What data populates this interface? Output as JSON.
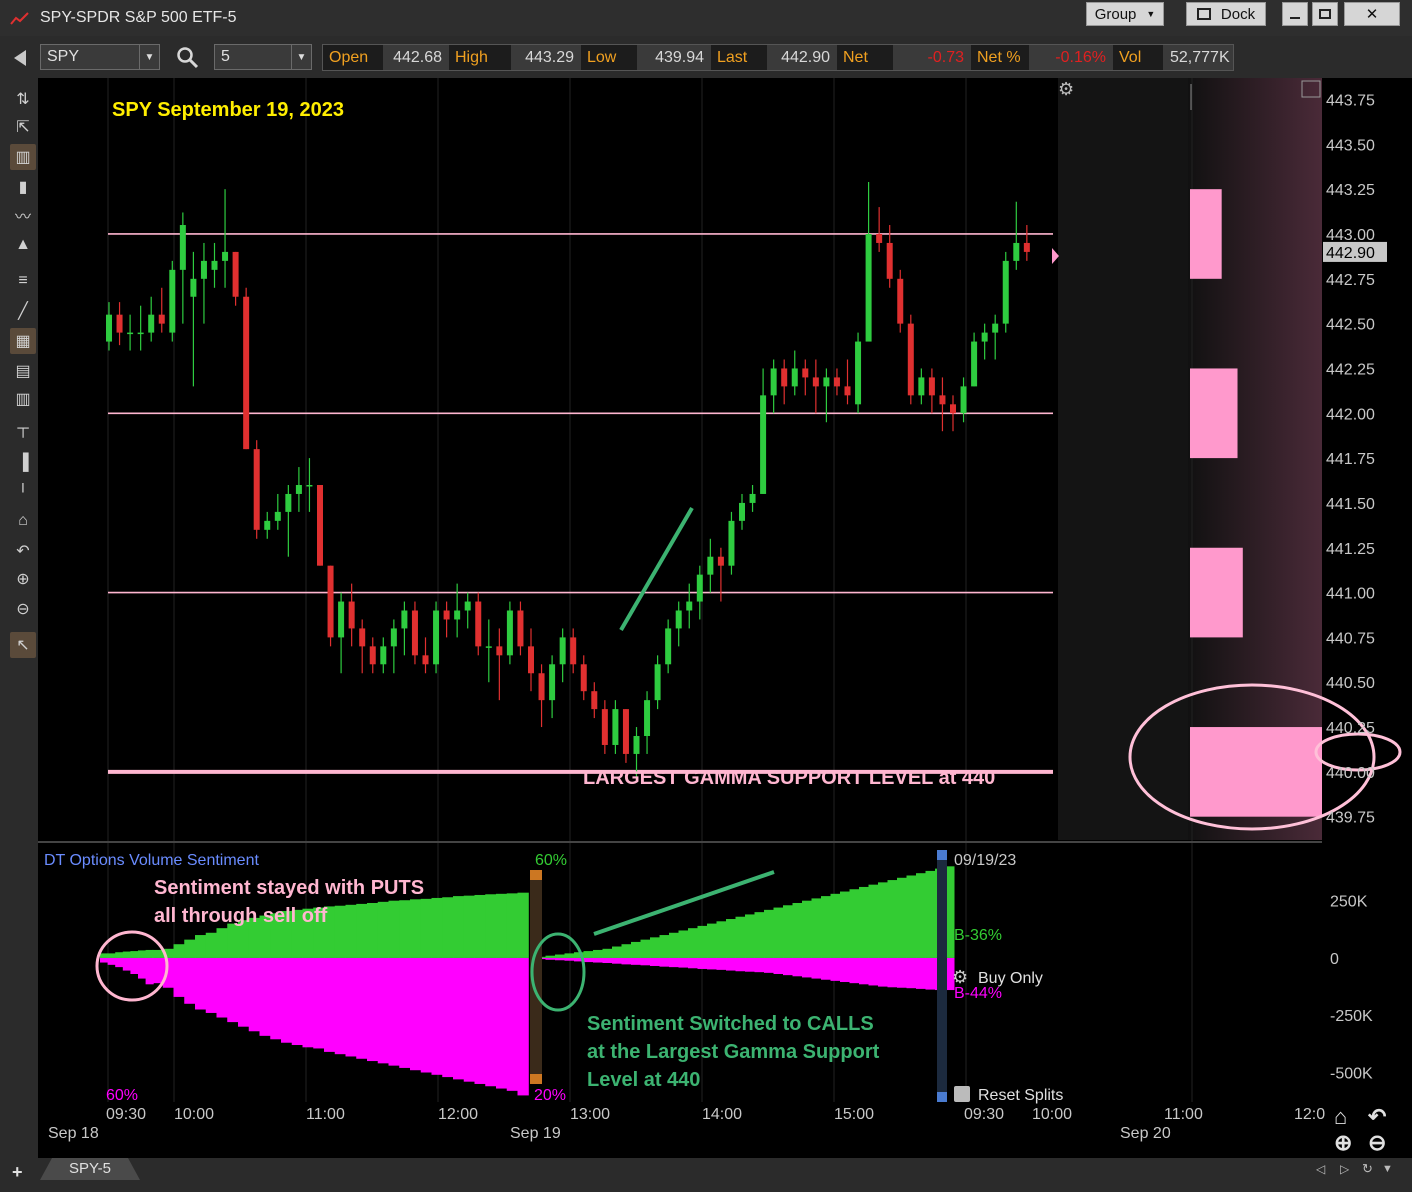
{
  "window": {
    "title": "SPY-SPDR S&P 500 ETF-5",
    "group_label": "Group",
    "dock_label": "Dock"
  },
  "toolbar": {
    "symbol": "SPY",
    "interval": "5",
    "quote": [
      {
        "label": "Open",
        "value": "442.68",
        "negative": false
      },
      {
        "label": "High",
        "value": "443.29",
        "negative": false
      },
      {
        "label": "Low",
        "value": "439.94",
        "negative": false
      },
      {
        "label": "Last",
        "value": "442.90",
        "negative": false
      },
      {
        "label": "Net",
        "value": "-0.73",
        "negative": true
      },
      {
        "label": "Net %",
        "value": "-0.16%",
        "negative": true
      },
      {
        "label": "Vol",
        "value": "52,777K",
        "negative": false
      }
    ]
  },
  "left_tools": [
    "crosshair-icon",
    "cursor-arrow-icon",
    "candlestick-icon",
    "bar-chart-icon",
    "line-chart-icon",
    "area-chart-icon",
    "fibonacci-icon",
    "trendline-icon",
    "grid-icon",
    "table-icon",
    "small-table-icon",
    "horizontal-line-icon",
    "pin-icon",
    "small-pin-icon",
    "home-icon",
    "undo-icon",
    "zoom-in-icon",
    "zoom-out-icon",
    "pointer-icon"
  ],
  "colors": {
    "up": "#2ecc40",
    "down": "#e03030",
    "level_line": "#ffb6d0",
    "annotation_yellow": "#ffee00",
    "annotation_pink": "#ffb6d0",
    "annotation_green": "#3cb371",
    "sentiment_calls": "#33cc33",
    "sentiment_puts": "#ff00ff",
    "gamma_bar": "#ff99cc"
  },
  "price_axis": {
    "labels": [
      "443.75",
      "443.50",
      "443.25",
      "443.00",
      "442.75",
      "442.50",
      "442.25",
      "442.00",
      "441.75",
      "441.50",
      "441.25",
      "441.00",
      "440.75",
      "440.50",
      "440.25",
      "440.00",
      "439.75"
    ],
    "last_price_label": "442.90"
  },
  "annotations": {
    "chart_title": "SPY September 19, 2023",
    "gamma_label": "LARGEST GAMMA SUPPORT LEVEL at 440",
    "sentiment_puts_note_1": "Sentiment stayed with PUTS",
    "sentiment_puts_note_2": "all through sell off",
    "sentiment_calls_note_1": "Sentiment Switched to CALLS",
    "sentiment_calls_note_2": "at the Largest Gamma Support",
    "sentiment_calls_note_3": "Level at 440"
  },
  "sentiment_panel": {
    "title": "DT Options Volume Sentiment",
    "split_top_pct": "60%",
    "split_bottom_pct": "20%",
    "left_bottom_pct": "60%",
    "date_label": "09/19/23",
    "calls_label": "B-36%",
    "puts_label": "B-44%",
    "buy_only_label": "Buy Only",
    "reset_splits_label": "Reset Splits",
    "axis_labels": [
      "250K",
      "0",
      "-250K",
      "-500K"
    ]
  },
  "time_axis": {
    "times": [
      {
        "label": "09:30"
      },
      {
        "label": "10:00"
      },
      {
        "label": "11:00"
      },
      {
        "label": "12:00"
      },
      {
        "label": "13:00"
      },
      {
        "label": "14:00"
      },
      {
        "label": "15:00"
      },
      {
        "label": "09:30"
      },
      {
        "label": "10:00"
      },
      {
        "label": "11:00"
      },
      {
        "label": "12:0"
      }
    ],
    "dates": [
      {
        "label": "Sep 18"
      },
      {
        "label": "Sep 19"
      },
      {
        "label": "Sep 20"
      }
    ]
  },
  "chart_data": {
    "type": "candlestick",
    "title": "SPY September 19, 2023",
    "interval_minutes": 5,
    "ylim": [
      439.62,
      443.87
    ],
    "horizontal_levels": [
      443.0,
      442.0,
      441.0,
      440.0
    ],
    "candles": [
      {
        "o": 442.4,
        "h": 442.62,
        "l": 442.35,
        "c": 442.55
      },
      {
        "o": 442.55,
        "h": 442.62,
        "l": 442.38,
        "c": 442.45
      },
      {
        "o": 442.45,
        "h": 442.55,
        "l": 442.35,
        "c": 442.45
      },
      {
        "o": 442.45,
        "h": 442.6,
        "l": 442.35,
        "c": 442.45
      },
      {
        "o": 442.45,
        "h": 442.65,
        "l": 442.4,
        "c": 442.55
      },
      {
        "o": 442.55,
        "h": 442.7,
        "l": 442.45,
        "c": 442.5
      },
      {
        "o": 442.45,
        "h": 442.85,
        "l": 442.4,
        "c": 442.8
      },
      {
        "o": 442.8,
        "h": 443.12,
        "l": 442.5,
        "c": 443.05
      },
      {
        "o": 442.65,
        "h": 442.9,
        "l": 442.15,
        "c": 442.75
      },
      {
        "o": 442.75,
        "h": 442.95,
        "l": 442.5,
        "c": 442.85
      },
      {
        "o": 442.8,
        "h": 442.95,
        "l": 442.7,
        "c": 442.85
      },
      {
        "o": 442.85,
        "h": 443.25,
        "l": 442.7,
        "c": 442.9
      },
      {
        "o": 442.9,
        "h": 442.9,
        "l": 442.6,
        "c": 442.65
      },
      {
        "o": 442.65,
        "h": 442.7,
        "l": 441.8,
        "c": 441.8
      },
      {
        "o": 441.8,
        "h": 441.85,
        "l": 441.3,
        "c": 441.35
      },
      {
        "o": 441.35,
        "h": 441.45,
        "l": 441.3,
        "c": 441.4
      },
      {
        "o": 441.4,
        "h": 441.55,
        "l": 441.35,
        "c": 441.45
      },
      {
        "o": 441.45,
        "h": 441.6,
        "l": 441.2,
        "c": 441.55
      },
      {
        "o": 441.55,
        "h": 441.7,
        "l": 441.45,
        "c": 441.6
      },
      {
        "o": 441.6,
        "h": 441.75,
        "l": 441.45,
        "c": 441.6
      },
      {
        "o": 441.6,
        "h": 441.6,
        "l": 441.15,
        "c": 441.15
      },
      {
        "o": 441.15,
        "h": 441.15,
        "l": 440.7,
        "c": 440.75
      },
      {
        "o": 440.75,
        "h": 441.0,
        "l": 440.55,
        "c": 440.95
      },
      {
        "o": 440.95,
        "h": 441.05,
        "l": 440.7,
        "c": 440.8
      },
      {
        "o": 440.8,
        "h": 440.85,
        "l": 440.55,
        "c": 440.7
      },
      {
        "o": 440.7,
        "h": 440.75,
        "l": 440.55,
        "c": 440.6
      },
      {
        "o": 440.6,
        "h": 440.75,
        "l": 440.55,
        "c": 440.7
      },
      {
        "o": 440.7,
        "h": 440.85,
        "l": 440.55,
        "c": 440.8
      },
      {
        "o": 440.8,
        "h": 440.95,
        "l": 440.65,
        "c": 440.9
      },
      {
        "o": 440.9,
        "h": 440.95,
        "l": 440.6,
        "c": 440.65
      },
      {
        "o": 440.65,
        "h": 440.75,
        "l": 440.55,
        "c": 440.6
      },
      {
        "o": 440.6,
        "h": 440.95,
        "l": 440.55,
        "c": 440.9
      },
      {
        "o": 440.9,
        "h": 440.95,
        "l": 440.75,
        "c": 440.85
      },
      {
        "o": 440.85,
        "h": 441.05,
        "l": 440.75,
        "c": 440.9
      },
      {
        "o": 440.9,
        "h": 441.0,
        "l": 440.8,
        "c": 440.95
      },
      {
        "o": 440.95,
        "h": 441.0,
        "l": 440.65,
        "c": 440.7
      },
      {
        "o": 440.7,
        "h": 440.85,
        "l": 440.5,
        "c": 440.7
      },
      {
        "o": 440.7,
        "h": 440.8,
        "l": 440.4,
        "c": 440.65
      },
      {
        "o": 440.65,
        "h": 440.95,
        "l": 440.6,
        "c": 440.9
      },
      {
        "o": 440.9,
        "h": 440.95,
        "l": 440.65,
        "c": 440.7
      },
      {
        "o": 440.7,
        "h": 440.8,
        "l": 440.45,
        "c": 440.55
      },
      {
        "o": 440.55,
        "h": 440.6,
        "l": 440.25,
        "c": 440.4
      },
      {
        "o": 440.4,
        "h": 440.65,
        "l": 440.3,
        "c": 440.6
      },
      {
        "o": 440.6,
        "h": 440.8,
        "l": 440.5,
        "c": 440.75
      },
      {
        "o": 440.75,
        "h": 440.8,
        "l": 440.55,
        "c": 440.6
      },
      {
        "o": 440.6,
        "h": 440.65,
        "l": 440.4,
        "c": 440.45
      },
      {
        "o": 440.45,
        "h": 440.5,
        "l": 440.3,
        "c": 440.35
      },
      {
        "o": 440.35,
        "h": 440.4,
        "l": 440.1,
        "c": 440.15
      },
      {
        "o": 440.15,
        "h": 440.4,
        "l": 440.1,
        "c": 440.35
      },
      {
        "o": 440.35,
        "h": 440.35,
        "l": 440.05,
        "c": 440.1
      },
      {
        "o": 440.1,
        "h": 440.25,
        "l": 439.94,
        "c": 440.2
      },
      {
        "o": 440.2,
        "h": 440.45,
        "l": 440.1,
        "c": 440.4
      },
      {
        "o": 440.4,
        "h": 440.65,
        "l": 440.35,
        "c": 440.6
      },
      {
        "o": 440.6,
        "h": 440.85,
        "l": 440.55,
        "c": 440.8
      },
      {
        "o": 440.8,
        "h": 440.95,
        "l": 440.7,
        "c": 440.9
      },
      {
        "o": 440.9,
        "h": 441.05,
        "l": 440.8,
        "c": 440.95
      },
      {
        "o": 440.95,
        "h": 441.15,
        "l": 440.85,
        "c": 441.1
      },
      {
        "o": 441.1,
        "h": 441.3,
        "l": 441.0,
        "c": 441.2
      },
      {
        "o": 441.2,
        "h": 441.25,
        "l": 440.95,
        "c": 441.15
      },
      {
        "o": 441.15,
        "h": 441.45,
        "l": 441.1,
        "c": 441.4
      },
      {
        "o": 441.4,
        "h": 441.55,
        "l": 441.35,
        "c": 441.5
      },
      {
        "o": 441.5,
        "h": 441.6,
        "l": 441.45,
        "c": 441.55
      },
      {
        "o": 441.55,
        "h": 442.25,
        "l": 441.55,
        "c": 442.1
      },
      {
        "o": 442.1,
        "h": 442.3,
        "l": 442.0,
        "c": 442.25
      },
      {
        "o": 442.25,
        "h": 442.3,
        "l": 442.05,
        "c": 442.15
      },
      {
        "o": 442.15,
        "h": 442.35,
        "l": 442.1,
        "c": 442.25
      },
      {
        "o": 442.25,
        "h": 442.3,
        "l": 442.1,
        "c": 442.2
      },
      {
        "o": 442.2,
        "h": 442.3,
        "l": 442.0,
        "c": 442.15
      },
      {
        "o": 442.15,
        "h": 442.25,
        "l": 441.95,
        "c": 442.2
      },
      {
        "o": 442.2,
        "h": 442.25,
        "l": 442.1,
        "c": 442.15
      },
      {
        "o": 442.15,
        "h": 442.3,
        "l": 442.05,
        "c": 442.1
      },
      {
        "o": 442.05,
        "h": 442.45,
        "l": 442.0,
        "c": 442.4
      },
      {
        "o": 442.4,
        "h": 443.29,
        "l": 442.4,
        "c": 443.0
      },
      {
        "o": 443.0,
        "h": 443.15,
        "l": 442.9,
        "c": 442.95
      },
      {
        "o": 442.95,
        "h": 443.05,
        "l": 442.7,
        "c": 442.75
      },
      {
        "o": 442.75,
        "h": 442.8,
        "l": 442.45,
        "c": 442.5
      },
      {
        "o": 442.5,
        "h": 442.55,
        "l": 442.05,
        "c": 442.1
      },
      {
        "o": 442.1,
        "h": 442.25,
        "l": 442.05,
        "c": 442.2
      },
      {
        "o": 442.2,
        "h": 442.25,
        "l": 442.0,
        "c": 442.1
      },
      {
        "o": 442.1,
        "h": 442.2,
        "l": 441.9,
        "c": 442.05
      },
      {
        "o": 442.05,
        "h": 442.1,
        "l": 441.9,
        "c": 442.0
      },
      {
        "o": 442.0,
        "h": 442.2,
        "l": 441.95,
        "c": 442.15
      },
      {
        "o": 442.15,
        "h": 442.45,
        "l": 442.15,
        "c": 442.4
      },
      {
        "o": 442.4,
        "h": 442.5,
        "l": 442.3,
        "c": 442.45
      },
      {
        "o": 442.45,
        "h": 442.55,
        "l": 442.3,
        "c": 442.5
      },
      {
        "o": 442.5,
        "h": 442.9,
        "l": 442.45,
        "c": 442.85
      },
      {
        "o": 442.85,
        "h": 443.18,
        "l": 442.8,
        "c": 442.95
      },
      {
        "o": 442.95,
        "h": 443.05,
        "l": 442.85,
        "c": 442.9
      }
    ],
    "gamma_levels": [
      {
        "from": 442.75,
        "to": 443.25,
        "relative": 0.18
      },
      {
        "from": 441.75,
        "to": 442.25,
        "relative": 0.27
      },
      {
        "from": 440.75,
        "to": 441.25,
        "relative": 0.3
      },
      {
        "from": 439.75,
        "to": 440.25,
        "relative": 0.75
      }
    ],
    "sentiment": {
      "unit": "contracts",
      "prior_day_calls": [
        20,
        20,
        25,
        28,
        30,
        33,
        35
      ],
      "prior_day_puts": [
        -20,
        -30,
        -40,
        -55,
        -70,
        -90,
        -115
      ],
      "calls": [
        35,
        40,
        60,
        80,
        100,
        110,
        130,
        150,
        165,
        175,
        185,
        195,
        205,
        210,
        215,
        220,
        225,
        228,
        232,
        236,
        240,
        245,
        250,
        252,
        256,
        258,
        262,
        265,
        270,
        272,
        275,
        278,
        280,
        282,
        285
      ],
      "puts": [
        -110,
        -130,
        -170,
        -200,
        -225,
        -240,
        -260,
        -280,
        -300,
        -320,
        -340,
        -355,
        -370,
        -380,
        -390,
        -395,
        -410,
        -420,
        -430,
        -440,
        -450,
        -460,
        -470,
        -480,
        -490,
        -500,
        -510,
        -520,
        -530,
        -540,
        -550,
        -560,
        -570,
        -580,
        -600
      ],
      "post_calls": [
        5,
        10,
        15,
        20,
        25,
        30,
        35,
        40,
        50,
        60,
        70,
        80,
        90,
        100,
        110,
        120,
        130,
        140,
        150,
        160,
        170,
        180,
        190,
        200,
        210,
        220,
        230,
        240,
        250,
        260,
        270,
        280,
        290,
        300,
        310,
        320,
        330,
        340,
        350,
        360,
        370,
        380,
        390,
        400
      ],
      "post_puts": [
        -5,
        -8,
        -10,
        -12,
        -15,
        -18,
        -20,
        -22,
        -25,
        -28,
        -30,
        -32,
        -35,
        -38,
        -40,
        -42,
        -45,
        -48,
        -50,
        -52,
        -55,
        -58,
        -60,
        -62,
        -65,
        -70,
        -75,
        -80,
        -85,
        -90,
        -95,
        -100,
        -105,
        -110,
        -115,
        -120,
        -125,
        -128,
        -130,
        -132,
        -135,
        -138,
        -140,
        -140
      ],
      "ylim": [
        -620,
        480
      ]
    }
  }
}
